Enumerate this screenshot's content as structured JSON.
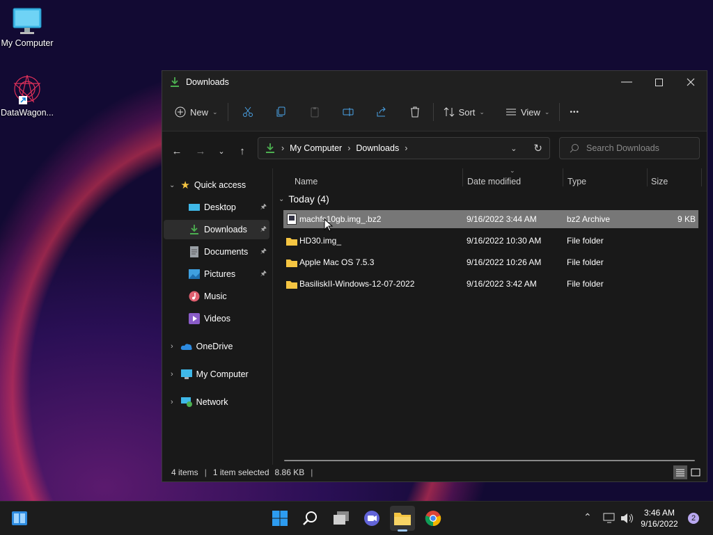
{
  "desktop": {
    "icons": [
      {
        "label": "My Computer",
        "icon": "monitor-icon"
      },
      {
        "label": "DataWagon...",
        "icon": "datawagon-shortcut-icon"
      }
    ]
  },
  "window": {
    "title": "Downloads",
    "toolbar": {
      "new_label": "New",
      "sort_label": "Sort",
      "view_label": "View",
      "more_label": "•••"
    },
    "breadcrumb": [
      "My Computer",
      "Downloads"
    ],
    "breadcrumb_sep": "›",
    "search_placeholder": "Search Downloads",
    "sidebar": {
      "quick_access": "Quick access",
      "items": [
        {
          "label": "Desktop",
          "pinned": true
        },
        {
          "label": "Downloads",
          "pinned": true,
          "selected": true
        },
        {
          "label": "Documents",
          "pinned": true
        },
        {
          "label": "Pictures",
          "pinned": true
        },
        {
          "label": "Music"
        },
        {
          "label": "Videos"
        }
      ],
      "roots": [
        {
          "label": "OneDrive"
        },
        {
          "label": "My Computer"
        },
        {
          "label": "Network"
        }
      ]
    },
    "columns": {
      "name": "Name",
      "date": "Date modified",
      "type": "Type",
      "size": "Size"
    },
    "group_label": "Today (4)",
    "files": [
      {
        "name": "machfs10gb.img_.bz2",
        "date": "9/16/2022 3:44 AM",
        "type": "bz2 Archive",
        "size": "9 KB",
        "selected": true
      },
      {
        "name": "HD30.img_",
        "date": "9/16/2022 10:30 AM",
        "type": "File folder",
        "size": ""
      },
      {
        "name": "Apple Mac OS 7.5.3",
        "date": "9/16/2022 10:26 AM",
        "type": "File folder",
        "size": ""
      },
      {
        "name": "BasiliskII-Windows-12-07-2022",
        "date": "9/16/2022 3:42 AM",
        "type": "File folder",
        "size": ""
      }
    ],
    "status": {
      "count": "4 items",
      "selection": "1 item selected",
      "size": "8.86 KB"
    }
  },
  "taskbar": {
    "time": "3:46 AM",
    "date": "9/16/2022",
    "notifications": "2"
  },
  "colors": {
    "accent": "#0078d4",
    "folder": "#f5c542",
    "download_green": "#4caf50"
  }
}
